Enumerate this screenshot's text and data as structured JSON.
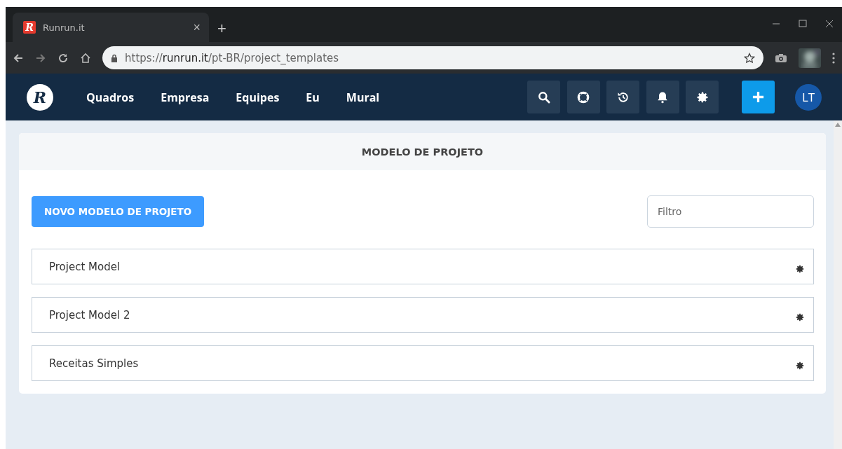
{
  "browser": {
    "favicon": "R",
    "tab_title": "Runrun.it",
    "tab_close": "×",
    "new_tab": "+",
    "url_scheme": "https://",
    "url_host": "runrun.it",
    "url_path": "/pt-BR/project_templates"
  },
  "nav": {
    "logo": "R",
    "items": [
      "Quadros",
      "Empresa",
      "Equipes",
      "Eu",
      "Mural"
    ],
    "avatar": "LT"
  },
  "panel": {
    "title": "MODELO DE PROJETO",
    "new_button": "NOVO MODELO DE PROJETO",
    "filter": {
      "placeholder": "Filtro"
    },
    "templates": [
      "Project Model",
      "Project Model 2",
      "Receitas Simples"
    ]
  }
}
